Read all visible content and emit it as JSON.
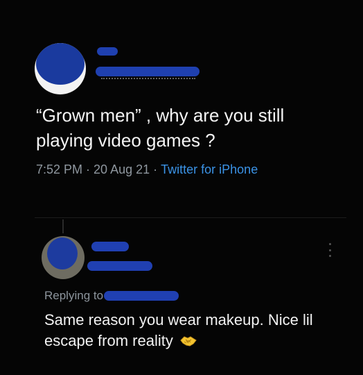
{
  "tweet": {
    "text": "“Grown men” , why are you still playing video games ?",
    "time": "7:52 PM",
    "date": "20 Aug 21",
    "source": "Twitter for iPhone",
    "separator": "·"
  },
  "reply": {
    "replying_to_label": "Replying to",
    "text": "Same reason you wear makeup. Nice lil escape from reality",
    "emoji": "handshake-emoji"
  },
  "colors": {
    "background": "#000000",
    "link_blue": "#3b93e6",
    "meta_gray": "#8f979f",
    "redaction_blue": "#1f40b0"
  }
}
